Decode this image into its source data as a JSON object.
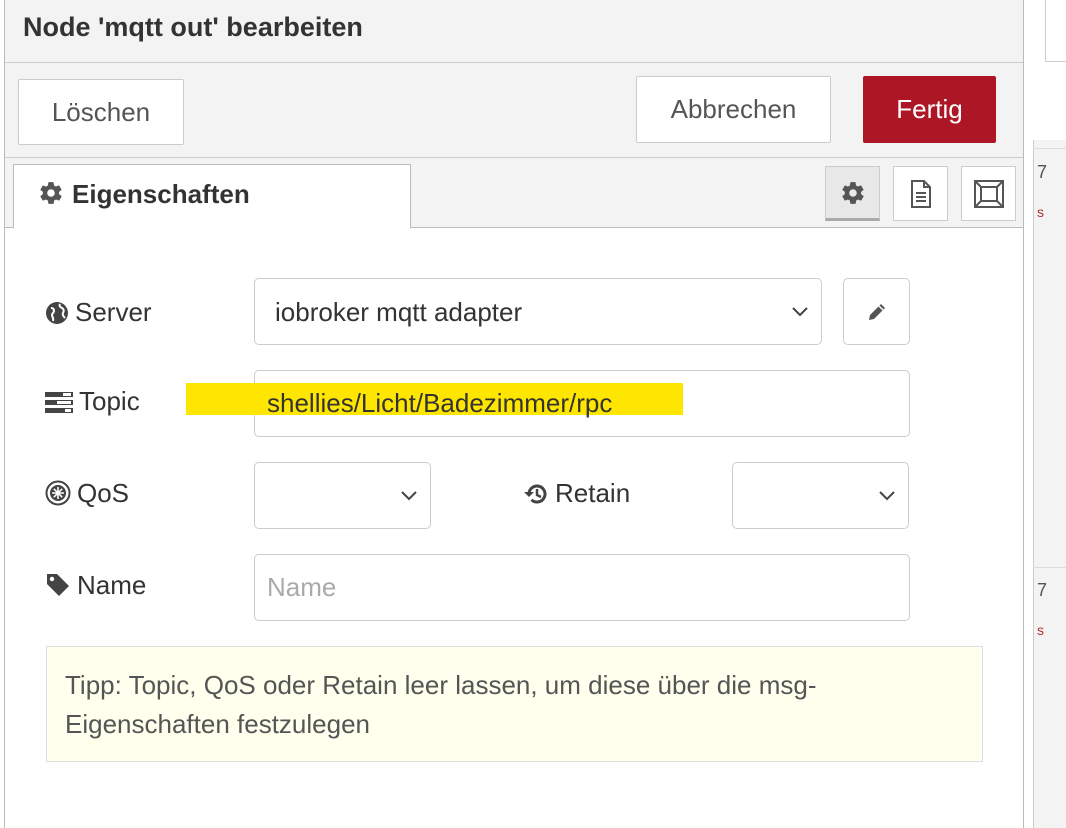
{
  "dialog": {
    "title": "Node 'mqtt out' bearbeiten",
    "buttons": {
      "delete": "Löschen",
      "cancel": "Abbrechen",
      "done": "Fertig"
    },
    "colors": {
      "done_button": "#ad1625",
      "highlight": "#ffe600",
      "tip_background": "#ffffee"
    }
  },
  "tabs": {
    "properties": {
      "label": "Eigenschaften",
      "icon": "gear-icon"
    },
    "icon_buttons": [
      "gear-icon",
      "document-icon",
      "frame-icon"
    ]
  },
  "form": {
    "server": {
      "label": "Server",
      "icon": "globe-icon",
      "value": "iobroker mqtt adapter"
    },
    "topic": {
      "label": "Topic",
      "icon": "tasks-icon",
      "value": "shellies/Licht/Badezimmer/rpc"
    },
    "qos": {
      "label": "QoS",
      "icon": "qos-icon",
      "value": ""
    },
    "retain": {
      "label": "Retain",
      "icon": "history-icon",
      "value": ""
    },
    "name": {
      "label": "Name",
      "icon": "tag-icon",
      "value": "",
      "placeholder": "Name"
    }
  },
  "tip": "Tipp: Topic, QoS oder Retain leer lassen, um diese über die msg-Eigenschaften festzulegen",
  "background": {
    "right_chars": [
      "7",
      "s",
      "7",
      "s"
    ]
  }
}
